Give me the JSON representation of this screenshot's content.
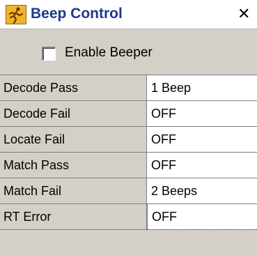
{
  "window": {
    "title": "Beep Control",
    "close_glyph": "✕",
    "icon": "running-figure-icon",
    "title_color": "#1b3a8a",
    "icon_color": "#f0b429"
  },
  "enable_beeper": {
    "label": "Enable Beeper",
    "checked": false
  },
  "grid": {
    "rows": [
      {
        "name": "Decode Pass",
        "value": "1 Beep"
      },
      {
        "name": "Decode Fail",
        "value": "OFF"
      },
      {
        "name": "Locate Fail",
        "value": "OFF"
      },
      {
        "name": "Match Pass",
        "value": "OFF"
      },
      {
        "name": "Match Fail",
        "value": "2 Beeps"
      },
      {
        "name": "RT Error",
        "value": "OFF"
      }
    ]
  }
}
